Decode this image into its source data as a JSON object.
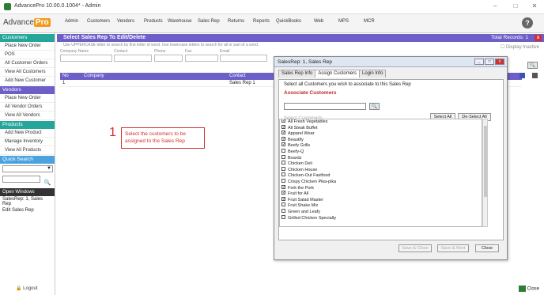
{
  "window": {
    "title": "AdvancePro 10.00.0.1004* - Admin"
  },
  "logo": {
    "text": "Advance",
    "pro": "Pro"
  },
  "menu": [
    "Admin",
    "Customers",
    "Vendors",
    "Products",
    "Warehouse",
    "Sales Rep",
    "Returns",
    "Reports",
    "QuickBooks",
    "Web",
    "MPS",
    "MCR"
  ],
  "sidebar": {
    "customers_header": "Customers",
    "customers_items": [
      "Place New Order",
      "POS",
      "All Customer Orders",
      "View All Customers",
      "Add New Customer"
    ],
    "vendors_header": "Vendors",
    "vendors_items": [
      "Place New Order",
      "All Vendor Orders",
      "View All Vendors"
    ],
    "products_header": "Products",
    "products_items": [
      "Add New Product",
      "Manage Inventory",
      "View All Products"
    ],
    "quick_search": "Quick Search",
    "open_windows": "Open Windows",
    "open_window_items": [
      "SalesRep: 1, Sales Rep",
      "Edit Sales Rep"
    ],
    "logout": "Logout"
  },
  "main": {
    "header": "Select Sales Rep To Edit/Delete",
    "total_records_label": "Total Records:",
    "total_records": "1",
    "hint": "Use UPPERCASE letter to search by first letter of word. Use lowercase letters to search for all or part of a word.",
    "display_inactive": "Display Inactive",
    "filters": [
      "Company Name",
      "Contact",
      "Phone",
      "Fax",
      "Email"
    ],
    "columns": [
      "No",
      "Company",
      "Contact"
    ],
    "rows": [
      {
        "no": "1",
        "company": "",
        "contact": "Sales Rep 1"
      }
    ],
    "close": "Close"
  },
  "annotation": {
    "number": "1",
    "text": "Select the customers to be assigned to the Sales Rep"
  },
  "dialog": {
    "title": "SalesRep: 1, Sales Rep",
    "tabs": [
      "Sales Rep Info",
      "Assign Customers",
      "Login Info"
    ],
    "instruction": "Select all Customers you wish to associate to this Sales Rep",
    "section": "Associate Customers",
    "list_label": "Select Customer/s",
    "select_all": "Select All",
    "deselect_all": "De-Select All",
    "customers": [
      {
        "name": "All Fresh Vegetables",
        "checked": true
      },
      {
        "name": "All Steak Buffet",
        "checked": true
      },
      {
        "name": "Apparel Wear",
        "checked": true
      },
      {
        "name": "Beautify",
        "checked": true
      },
      {
        "name": "Beefy Grills",
        "checked": true
      },
      {
        "name": "Beefy-Q",
        "checked": false
      },
      {
        "name": "Boardz",
        "checked": false
      },
      {
        "name": "Chicken Deli",
        "checked": false
      },
      {
        "name": "Chicken House",
        "checked": false
      },
      {
        "name": "Chicken-Out Fastfood",
        "checked": false
      },
      {
        "name": "Crispy Chicken Pika-pika",
        "checked": false
      },
      {
        "name": "Fork the Pork",
        "checked": true
      },
      {
        "name": "Fruit for All",
        "checked": true
      },
      {
        "name": "Fruit Salad Master",
        "checked": true
      },
      {
        "name": "Fruit Shake Mix",
        "checked": false
      },
      {
        "name": "Green and Leafy",
        "checked": false
      },
      {
        "name": "Grilled Chicken Specialty",
        "checked": false
      }
    ],
    "save_close": "Save & Close",
    "save_next": "Save & Next",
    "close": "Close"
  }
}
